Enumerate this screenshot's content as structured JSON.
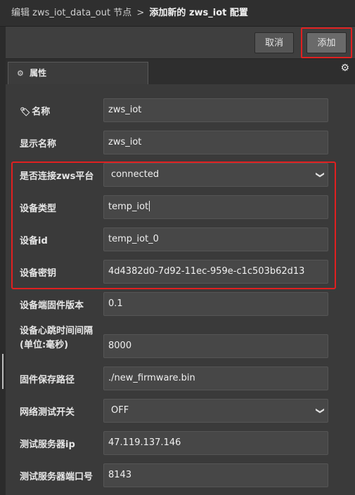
{
  "breadcrumb": {
    "node": "编辑 zws_iot_data_out 节点",
    "separator": ">",
    "current": "添加新的 zws_iot 配置"
  },
  "toolbar": {
    "cancel_label": "取消",
    "add_label": "添加"
  },
  "tabs": {
    "properties_label": "属性"
  },
  "icons": {
    "tab_icon": "gear-icon",
    "settings_icon": "gear-icon",
    "name_icon": "tag-icon",
    "select_icon": "chevron-down-icon"
  },
  "colors": {
    "highlight": "#e02020",
    "background": "#333333"
  },
  "form": {
    "name": {
      "label": "名称",
      "value": "zws_iot"
    },
    "display_name": {
      "label": "显示名称",
      "value": "zws_iot"
    },
    "connect_platform": {
      "label": "是否连接zws平台",
      "value": "connected"
    },
    "device_type": {
      "label": "设备类型",
      "value": "temp_iot"
    },
    "device_id": {
      "label": "设备id",
      "value": "temp_iot_0"
    },
    "device_secret": {
      "label": "设备密钥",
      "value": "4d4382d0-7d92-11ec-959e-c1c503b62d13"
    },
    "firmware_version": {
      "label": "设备端固件版本",
      "value": "0.1"
    },
    "heartbeat": {
      "label_line1": "设备心跳时间间隔",
      "label_line2": "(单位:毫秒)",
      "value": "8000"
    },
    "firmware_path": {
      "label": "固件保存路径",
      "value": "./new_firmware.bin"
    },
    "network_test": {
      "label": "网络测试开关",
      "value": "OFF"
    },
    "test_server_ip": {
      "label": "测试服务器ip",
      "value": "47.119.137.146"
    },
    "test_server_port": {
      "label": "测试服务器端口号",
      "value": "8143"
    }
  }
}
